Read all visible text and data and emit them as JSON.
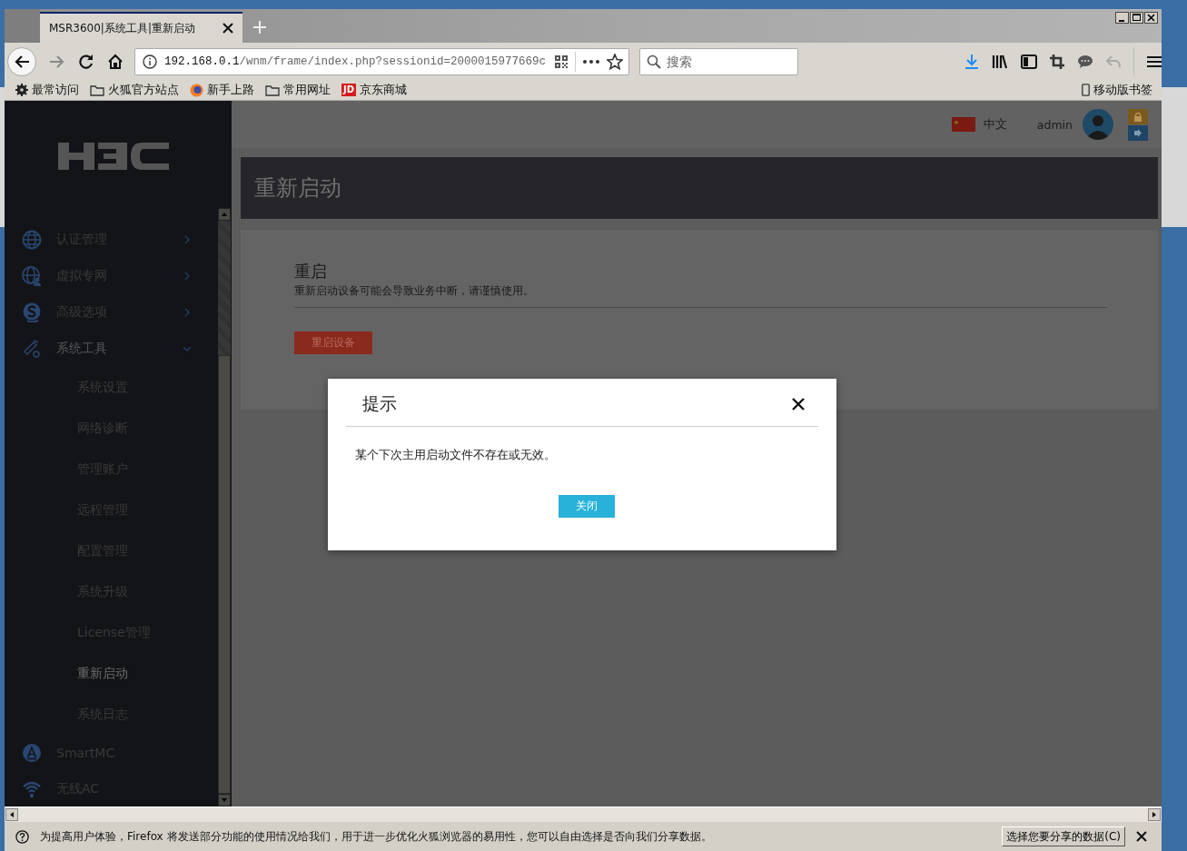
{
  "browser": {
    "tab_title": "MSR3600|系统工具|重新启动",
    "url_host": "192.168.0.1",
    "url_path": "/wnm/frame/index.php?sessionid=2000015977669c",
    "search": {
      "placeholder": "搜索"
    },
    "bookmarks": [
      {
        "label": "最常访问",
        "kind": "gear"
      },
      {
        "label": "火狐官方站点",
        "kind": "folder"
      },
      {
        "label": "新手上路",
        "kind": "firefox"
      },
      {
        "label": "常用网址",
        "kind": "folder"
      },
      {
        "label": "京东商城",
        "kind": "jd",
        "icon_text": "JD"
      }
    ],
    "mobile_bookmarks": "移动版书签"
  },
  "header": {
    "language": "中文",
    "user": "admin"
  },
  "sidebar": {
    "items": [
      {
        "label": "认证管理",
        "kind": "globe",
        "expanded": false,
        "selected": false
      },
      {
        "label": "虚拟专网",
        "kind": "globe-user",
        "expanded": false,
        "selected": false
      },
      {
        "label": "高级选项",
        "kind": "s-logo",
        "expanded": false,
        "selected": false
      },
      {
        "label": "系统工具",
        "kind": "tools",
        "expanded": true,
        "selected": false,
        "children": [
          {
            "label": "系统设置",
            "selected": false
          },
          {
            "label": "网络诊断",
            "selected": false
          },
          {
            "label": "管理账户",
            "selected": false
          },
          {
            "label": "远程管理",
            "selected": false
          },
          {
            "label": "配置管理",
            "selected": false
          },
          {
            "label": "系统升级",
            "selected": false
          },
          {
            "label": "License管理",
            "selected": false
          },
          {
            "label": "重新启动",
            "selected": true
          },
          {
            "label": "系统日志",
            "selected": false
          }
        ]
      },
      {
        "label": "SmartMC",
        "kind": "a-circle",
        "selected": false
      },
      {
        "label": "无线AC",
        "kind": "wifi",
        "selected": false
      }
    ]
  },
  "page": {
    "title": "重新启动",
    "section": {
      "title": "重启",
      "description": "重新启动设备可能会导致业务中断，请谨慎使用。",
      "button": "重启设备"
    }
  },
  "dialog": {
    "title": "提示",
    "message": "某个下次主用启动文件不存在或无效。",
    "button": "关闭"
  },
  "notification": {
    "message": "为提高用户体验，Firefox 将发送部分功能的使用情况给我们，用于进一步优化火狐浏览器的易用性，您可以自由选择是否向我们分享数据。",
    "button": "选择您要分享的数据(C)"
  }
}
